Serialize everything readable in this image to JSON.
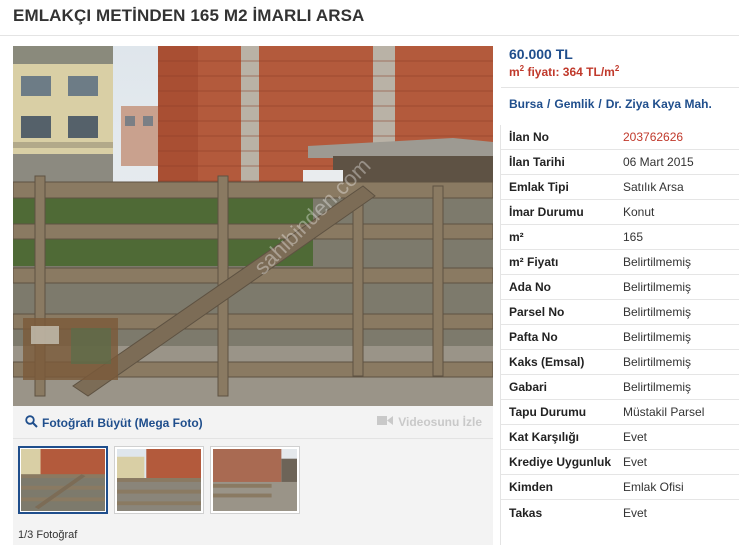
{
  "listing": {
    "title": "EMLAKÇI METİNDEN 165 M2 İMARLI ARSA",
    "price": "60.000 TL",
    "m2_price_prefix": "m",
    "m2_price_sup": "2",
    "m2_price_text": " fiyatı: 364 TL/m",
    "m2_price_sup2": "2",
    "location": [
      "Bursa",
      "Gemlik",
      "Dr. Ziya Kaya Mah."
    ],
    "location_sep": "/"
  },
  "gallery": {
    "enlarge_label": "Fotoğrafı Büyüt (Mega Foto)",
    "video_label": "Videosunu İzle",
    "count_label": "1/3 Fotoğraf",
    "watermark": "sahibinden.com"
  },
  "details": [
    {
      "key": "İlan No",
      "value": "203762626",
      "highlight": true
    },
    {
      "key": "İlan Tarihi",
      "value": "06 Mart 2015"
    },
    {
      "key": "Emlak Tipi",
      "value": "Satılık Arsa"
    },
    {
      "key": "İmar Durumu",
      "value": "Konut"
    },
    {
      "key": "m²",
      "value": "165"
    },
    {
      "key": "m² Fiyatı",
      "value": "Belirtilmemiş"
    },
    {
      "key": "Ada No",
      "value": "Belirtilmemiş"
    },
    {
      "key": "Parsel No",
      "value": "Belirtilmemiş"
    },
    {
      "key": "Pafta No",
      "value": "Belirtilmemiş"
    },
    {
      "key": "Kaks (Emsal)",
      "value": "Belirtilmemiş"
    },
    {
      "key": "Gabari",
      "value": "Belirtilmemiş"
    },
    {
      "key": "Tapu Durumu",
      "value": "Müstakil Parsel"
    },
    {
      "key": "Kat Karşılığı",
      "value": "Evet"
    },
    {
      "key": "Krediye Uygunluk",
      "value": "Evet"
    },
    {
      "key": "Kimden",
      "value": "Emlak Ofisi"
    },
    {
      "key": "Takas",
      "value": "Evet"
    }
  ],
  "colors": {
    "link": "#1f4e8c",
    "price_red": "#c0392b"
  }
}
